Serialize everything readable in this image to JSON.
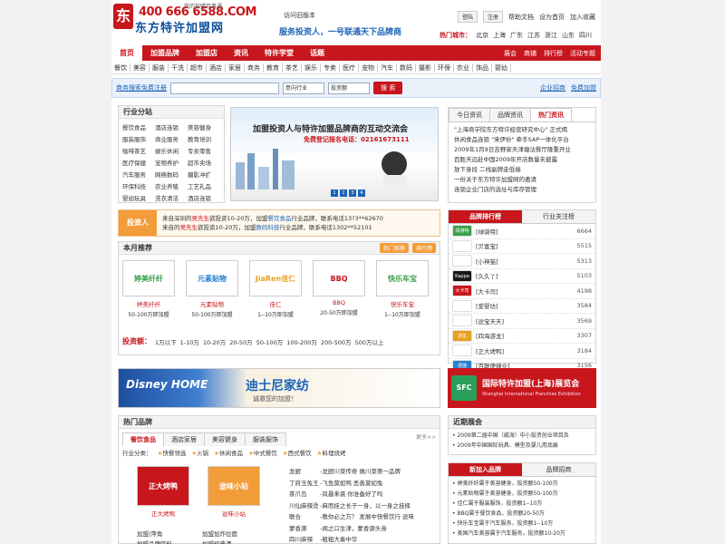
{
  "header": {
    "logo_char": "东",
    "phone": "400 666 6588.COM",
    "slogan": "我的加盟百事通",
    "site_name": "东方特许加盟网",
    "old_version": "访问旧版本",
    "tagline": "服务投资人，一号联通天下品牌商",
    "login": "登陆",
    "register": "注册",
    "links": [
      "帮助文档",
      "设为首页",
      "加入收藏"
    ],
    "hot_city_label": "热门城市：",
    "cities": [
      "北京",
      "上海",
      "广东",
      "江苏",
      "浙江",
      "山东",
      "四川"
    ]
  },
  "nav": {
    "items": [
      "首页",
      "加盟品牌",
      "加盟店",
      "资讯",
      "特许学堂",
      "话题"
    ],
    "active_index": 0,
    "right": [
      "展会",
      "商铺",
      "排行榜",
      "活动专题"
    ]
  },
  "subnav": [
    "餐饮",
    "美容",
    "服装",
    "干洗",
    "超市",
    "酒店",
    "家居",
    "商务",
    "教育",
    "茶艺",
    "娱乐",
    "专卖",
    "医疗",
    "宠物",
    "汽车",
    "数码",
    "摄影",
    "环保",
    "农业",
    "饰品",
    "婴幼"
  ],
  "search": {
    "label": "商务搜索免费注册",
    "placeholder": "",
    "industry": "意向行业",
    "amount": "投资额",
    "button": "搜 索",
    "right_links": [
      "企业招商",
      "免费加盟"
    ]
  },
  "industry": {
    "title": "行业分站",
    "items": [
      "餐饮食品",
      "酒店连锁",
      "美容健身",
      "服装服饰",
      "商业服务",
      "教育培训",
      "咖啡茶艺",
      "娱乐休闲",
      "专卖零售",
      "医疗保健",
      "宠物养护",
      "超市卖场",
      "汽车服务",
      "网络数码",
      "摄影冲扩",
      "环保科技",
      "农业养殖",
      "工艺礼品",
      "婴幼玩具",
      "洗衣清洁",
      "酒店连锁"
    ]
  },
  "banner": {
    "title": "加盟投资人与特许加盟品牌商的互动交流会",
    "sub": "免费登记报名电话：02161673111",
    "dots": [
      "1",
      "2",
      "3",
      "4"
    ]
  },
  "news": {
    "tabs": [
      "今日资讯",
      "品牌资讯",
      "热门资讯"
    ],
    "active_tab": 2,
    "items": [
      "\"上海商学院东方特许经营研究中心\" 正式揭",
      "休闲食品连锁 \"来伊份\" 牵手SAP一体化平台",
      "2009年1月9日吉野家天津塘沽餐厅隆重开业",
      "百胜天远赴中国2009年开店数量未披露",
      "放下身段 二线副牌走低端",
      "一份关于东方特许加盟网的邀请",
      "连锁企业门店的选址与库存管理"
    ]
  },
  "ticker": {
    "badge": "投资人",
    "lines": [
      {
        "pre": "来自深圳的",
        "name": "吴先生",
        "mid": "欲投资10-20万，加盟",
        "brand": "餐饮食品",
        "post": "行业品牌，联系电话13?3**62670"
      },
      {
        "pre": "来自的",
        "name": "吴先生",
        "mid": "欲投资10-20万，加盟",
        "brand": "数码科技",
        "post": "行业品牌，联系电话1302**52101"
      }
    ]
  },
  "ranking": {
    "tabs": [
      "品牌排行榜",
      "行业关注榜"
    ],
    "rows": [
      {
        "name": "[绿骑特]",
        "value": "6664",
        "color": "#3aa04a"
      },
      {
        "name": "[贝富宝]",
        "value": "5515",
        "color": "#ffffff"
      },
      {
        "name": "[小神猫]",
        "value": "5313",
        "color": "#ffffff"
      },
      {
        "name": "[久久丫]",
        "value": "5103",
        "color": "#1a1a1a"
      },
      {
        "name": "[大卡司]",
        "value": "4198",
        "color": "#c8161d"
      },
      {
        "name": "[爱婴坊]",
        "value": "3584",
        "color": "#ffffff"
      },
      {
        "name": "[途宝天天]",
        "value": "3569",
        "color": "#ffffff"
      },
      {
        "name": "[四海游龙]",
        "value": "3307",
        "color": "#e8a020"
      },
      {
        "name": "[正大烤鸭]",
        "value": "3184",
        "color": "#ffffff"
      },
      {
        "name": "[百联便捷业]",
        "value": "3156",
        "color": "#2a80d0"
      }
    ],
    "logo_text": [
      "绿骑特",
      "",
      "",
      "Kappa",
      "大卡司",
      "",
      "",
      "游龙",
      "",
      "便捷"
    ]
  },
  "monthly": {
    "title": "本月推荐",
    "buttons": [
      "热门推荐",
      "排行榜"
    ],
    "brands": [
      {
        "logo": "婷美纤纤",
        "name": "婷美纤纤",
        "invest": "50-100万即加盟",
        "color": "#3aa04a"
      },
      {
        "logo": "元素贴物",
        "name": "元素贴物",
        "invest": "50-100万即加盟",
        "color": "#2a80d0"
      },
      {
        "logo": "JiaRen佳仁",
        "name": "佳仁",
        "invest": "1--10万即加盟",
        "color": "#e8a020"
      },
      {
        "logo": "BBQ",
        "name": "BBQ",
        "invest": "20-50万即加盟",
        "color": "#c8161d"
      },
      {
        "logo": "快乐车宝",
        "name": "快乐车宝",
        "invest": "1--10万即加盟",
        "color": "#3aa04a"
      }
    ],
    "invest_label": "投资额：",
    "invest_ranges": [
      "1万以下",
      "1-10万",
      "10-20万",
      "20-50万",
      "50-100万",
      "100-200万",
      "200-500万",
      "500万以上"
    ]
  },
  "ads": {
    "disney_en": "Disney HOME",
    "disney_cn": "迪士尼家纺",
    "disney_sub": "诚邀您的加盟！",
    "sfc_logo": "SFC",
    "sfc_title": "国际特许加盟(上海)展览会",
    "sfc_sub": "Shanghai International Franchise Exhibition"
  },
  "hot": {
    "title": "热门品牌",
    "tabs": [
      "餐饮食品",
      "酒店家居",
      "美容健身",
      "服装服饰"
    ],
    "more": "更多>>",
    "cat_label": "行业分类：",
    "cats": [
      "快餐领选",
      "火锅",
      "休闲食品",
      "中式餐饮",
      "西式餐饮",
      "料理烧烤"
    ],
    "cards": [
      {
        "logo": "正大烤鸭",
        "name": "正大烤鸭",
        "color": "#c8161d"
      },
      {
        "logo": "途味小站",
        "name": "途味小站",
        "color": "#f39c3a"
      }
    ],
    "list": [
      {
        "a": "龙厨",
        "b": "-龙厨川菜传奇 做川菜第一品牌"
      },
      {
        "a": "丁府玉兔王",
        "b": "-飞鱼莫如鸭 恶善莫如兔"
      },
      {
        "a": "茶爪岛",
        "b": "-风暴来袭 你准备好了吗"
      },
      {
        "a": "川仙麻辣烫",
        "b": "-麻而挂之长于一身，以一身之挂择"
      },
      {
        "a": "联合",
        "b": "-教你必之方？ 发展中快餐饮行 途味"
      },
      {
        "a": "蒙香源",
        "b": "-闻之口生津，蒙香源头身"
      },
      {
        "a": "四川麻辣",
        "b": "-粗粗大奏中华"
      }
    ],
    "bottom": [
      "加盟|萍角",
      "加盟加炸拉面",
      "加盟品牌饮料",
      "加盟经典酒"
    ]
  },
  "recent": {
    "title": "近期展会",
    "items": [
      "2009第二届中国（威海）中小投资创业项目及",
      "2009年中国国际玩具、模型及婴儿用品展"
    ]
  },
  "newjoin": {
    "tabs": [
      "新加入品牌",
      "品牌招商"
    ],
    "items": [
      "婷美纤纤属于美容健身，投资额50-100万",
      "元素贴物属于美容健身，投资额50-100万",
      "佳仁属于服装服饰，投资额1--10万",
      "BBQ属于餐饮食品，投资额20-50万",
      "快乐车宝属于汽车服务，投资额1--10万",
      "美国汽车美容属于汽车服务，投资额10-20万"
    ]
  }
}
